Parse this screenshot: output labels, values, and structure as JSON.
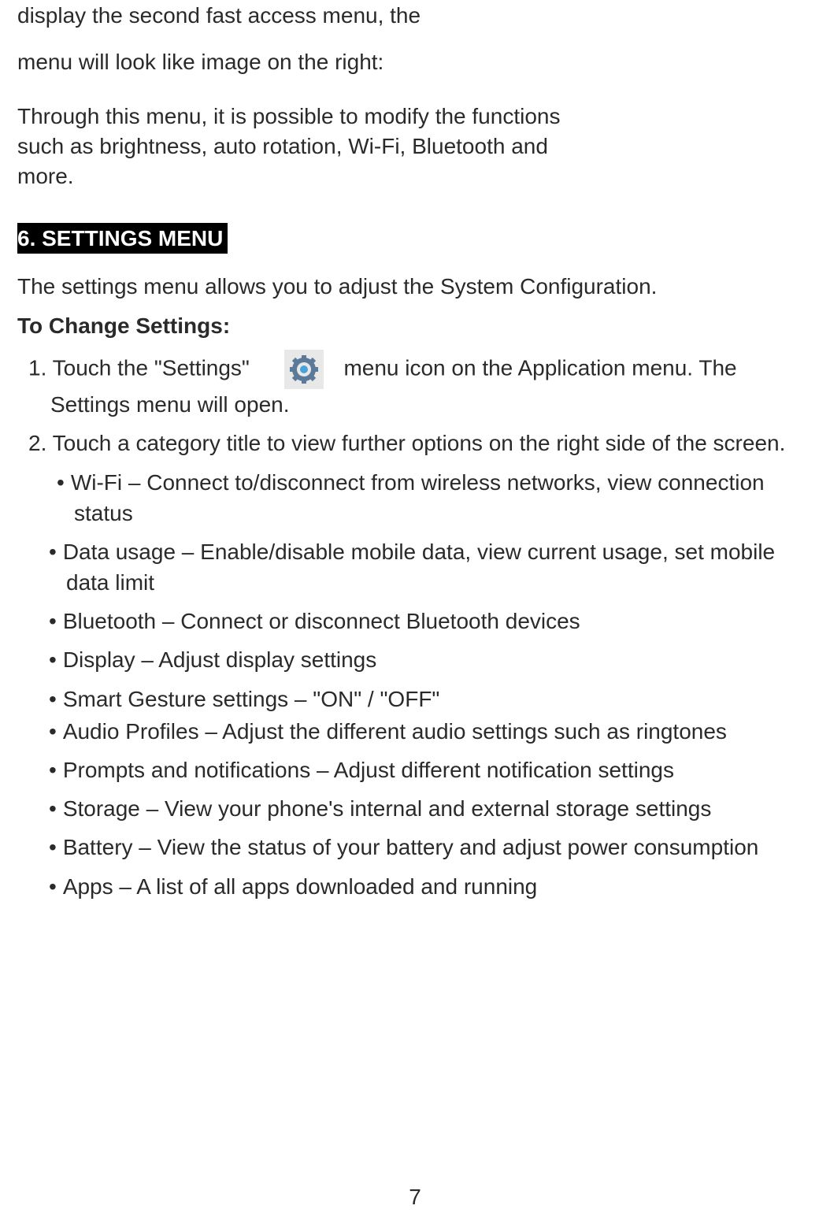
{
  "intro": {
    "line1": "display the second fast access menu, the",
    "line2": "menu will look like image on the right:",
    "para2": "Through this menu, it is possible to modify the functions such as brightness, auto rotation, Wi-Fi, Bluetooth and more."
  },
  "section": {
    "heading": "6.   SETTINGS MENU",
    "lead": "The settings menu allows you to adjust the System Configuration.",
    "subheading": "To Change Settings:"
  },
  "steps": {
    "one_a": "Touch  the  \"Settings\"",
    "one_b": "menu icon on the Application menu. The Settings menu will open.",
    "two": "Touch a category title to view further options on the right side of the screen."
  },
  "bullets": [
    "Wi-Fi – Connect to/disconnect from wireless networks, view connection status",
    "Data usage – Enable/disable mobile data, view current usage, set mobile data limit",
    "Bluetooth – Connect or disconnect Bluetooth devices",
    "Display – Adjust display settings",
    "Smart Gesture settings – \"ON\" / \"OFF\"",
    "Audio Profiles – Adjust the different audio settings such as ringtones",
    "Prompts and notifications – Adjust different notification  settings",
    "Storage – View your phone's internal and external storage settings",
    "Battery – View the status of your battery and adjust power consumption",
    "Apps – A list of all apps downloaded and running"
  ],
  "page_number": "7"
}
